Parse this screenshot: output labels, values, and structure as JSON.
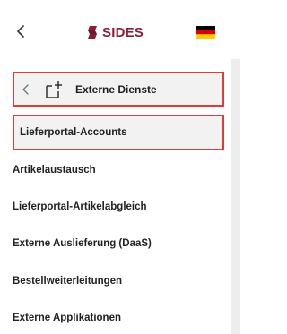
{
  "header": {
    "logo_text": "SIDES"
  },
  "submenu": {
    "title": "Externe Dienste"
  },
  "items": [
    {
      "label": "Lieferportal-Accounts",
      "active": true
    },
    {
      "label": "Artikelaustausch"
    },
    {
      "label": "Lieferportal-Artikelabgleich"
    },
    {
      "label": "Externe Auslieferung (DaaS)"
    },
    {
      "label": "Bestellweiterleitungen"
    },
    {
      "label": "Externe Applikationen"
    }
  ],
  "colors": {
    "brand": "#8c1d3a",
    "highlight_border": "#e53935",
    "item_background": "#f2f2f2"
  },
  "icons": [
    "back-chevron-icon",
    "sides-logo-icon",
    "german-flag-icon",
    "add-page-icon"
  ]
}
